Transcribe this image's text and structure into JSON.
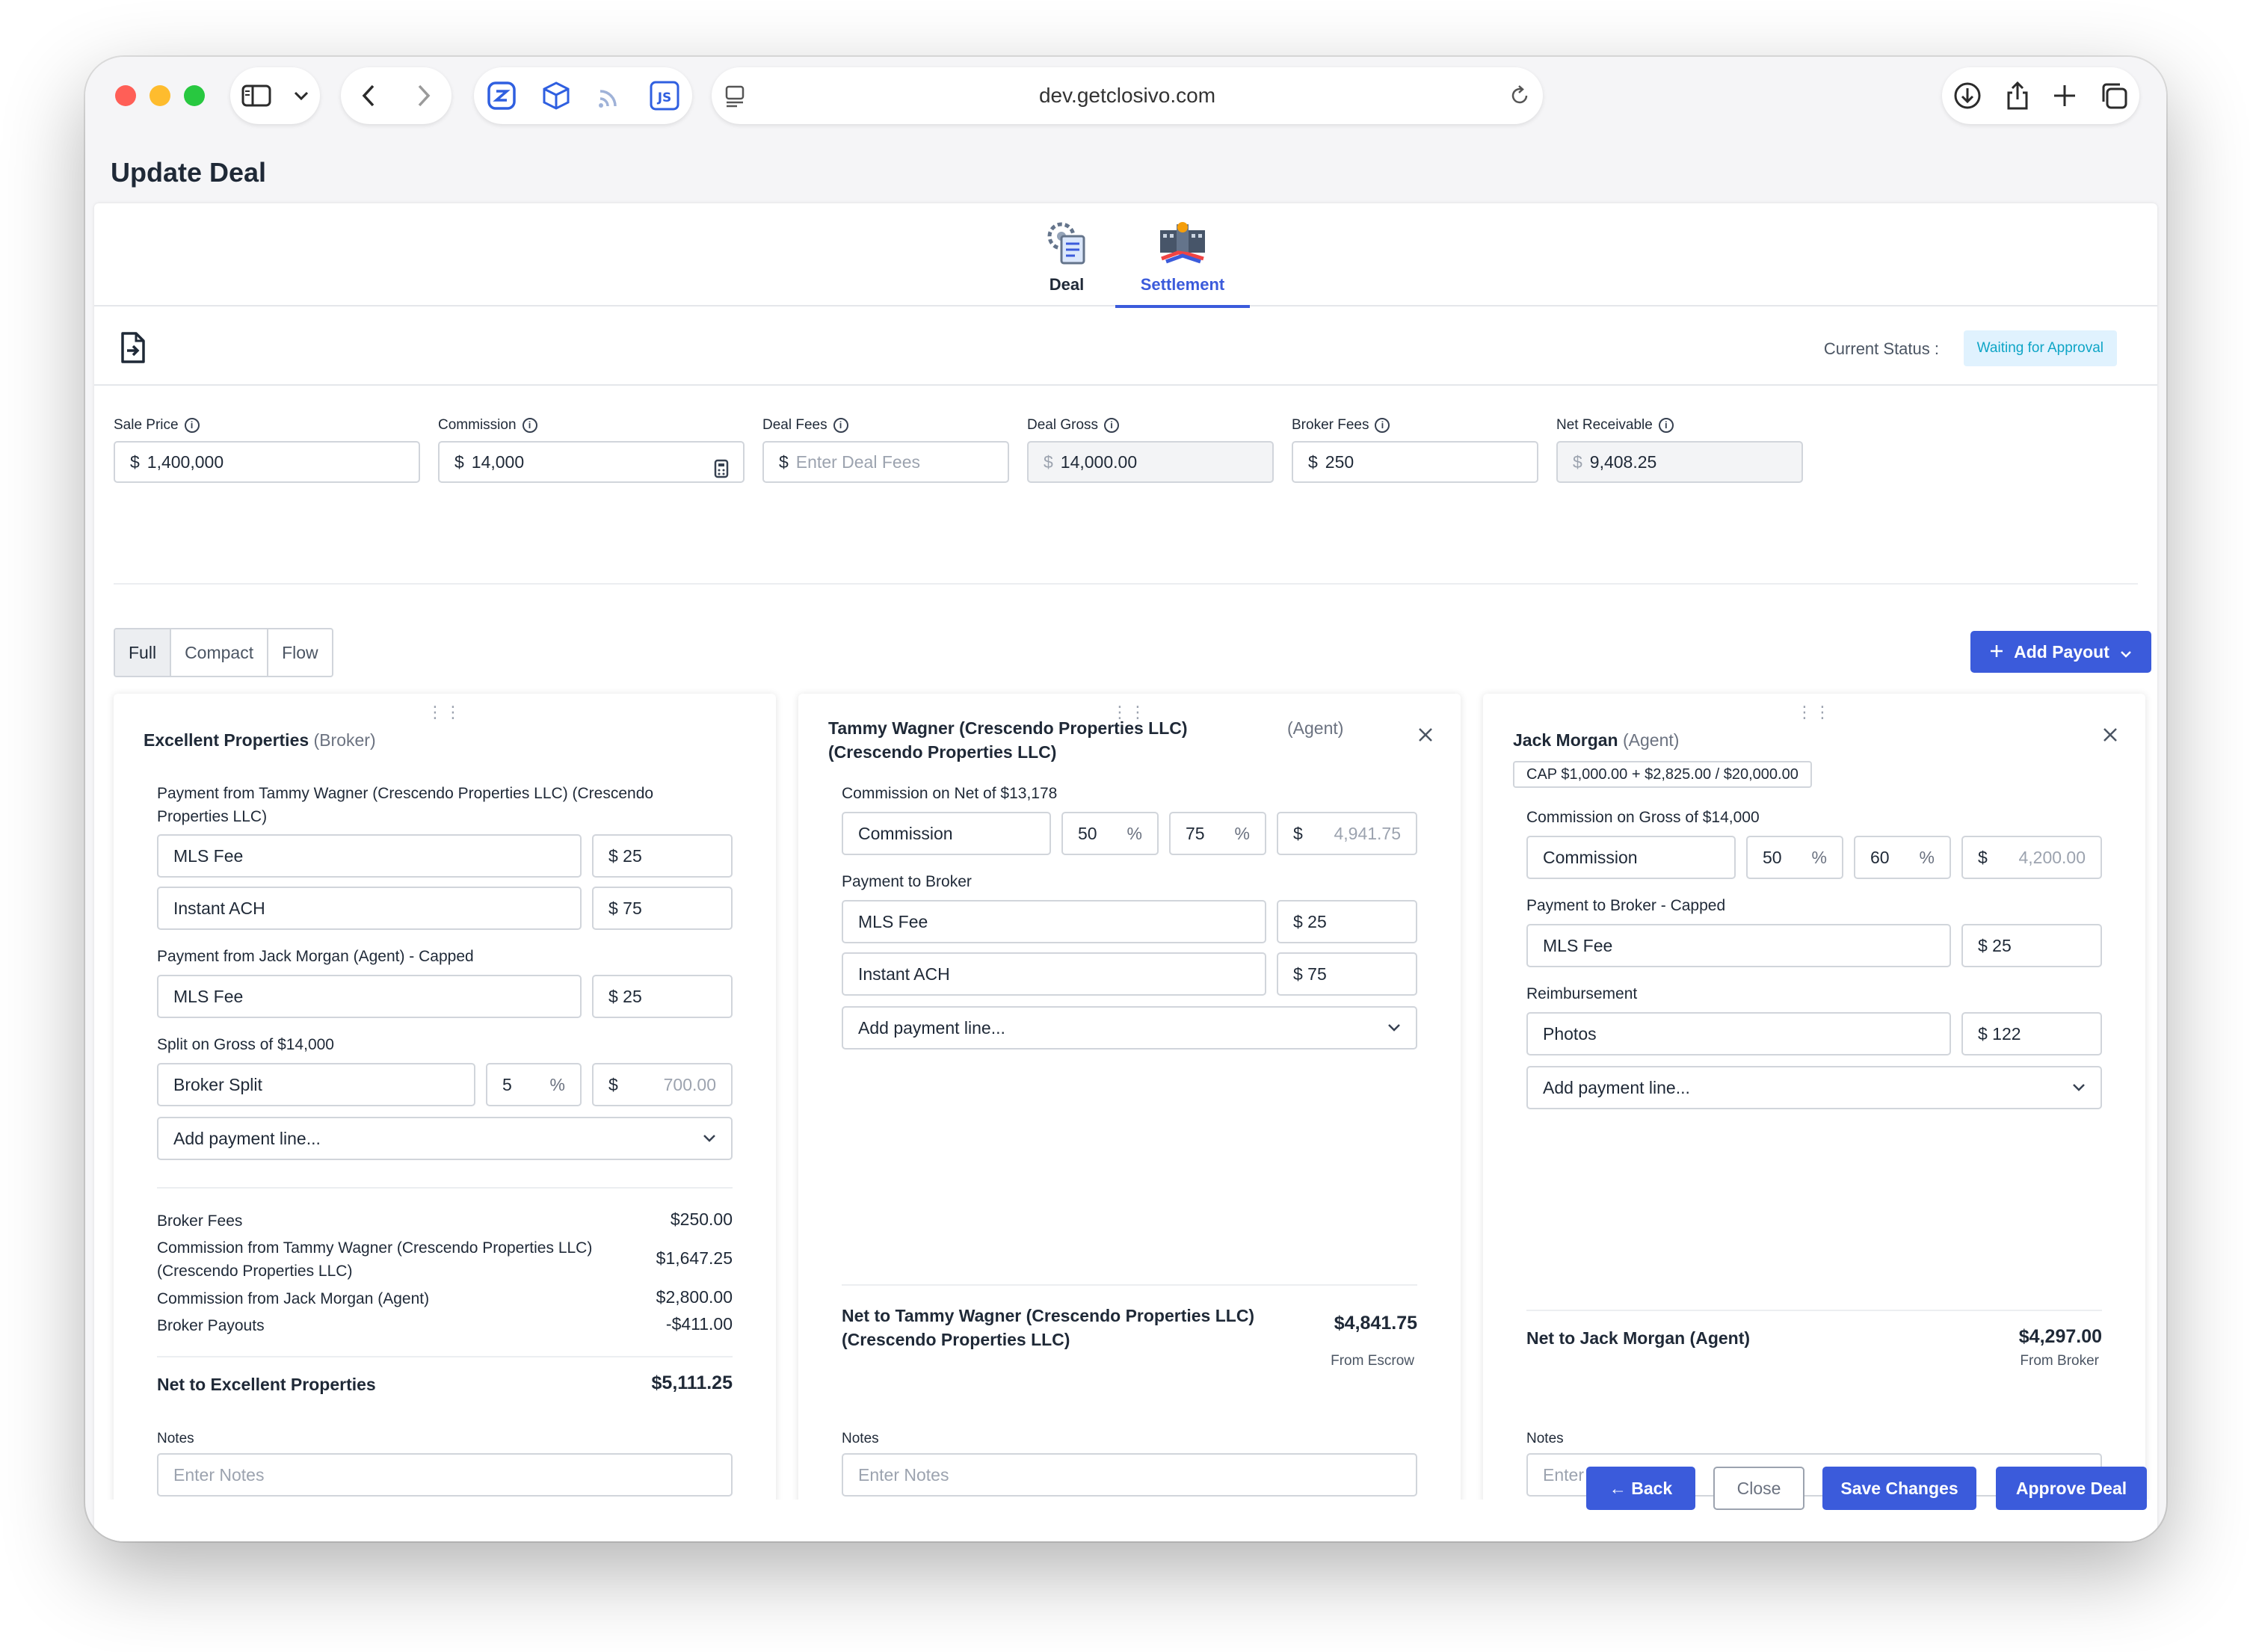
{
  "browser": {
    "url": "dev.getclosivo.com",
    "icons": [
      "sidebar-icon",
      "chevron-down-icon",
      "back-icon",
      "forward-icon",
      "extension-icon",
      "cube-icon",
      "rss-icon",
      "js-icon",
      "page-icon",
      "reload-icon",
      "download-icon",
      "share-icon",
      "new-tab-icon",
      "tabs-overview-icon"
    ]
  },
  "page": {
    "title": "Update Deal"
  },
  "tabs": [
    {
      "label": "Deal",
      "active": false
    },
    {
      "label": "Settlement",
      "active": true
    }
  ],
  "status": {
    "label": "Current Status :",
    "value": "Waiting for Approval"
  },
  "summary_fields": [
    {
      "label": "Sale Price",
      "prefix": "$",
      "value": "1,400,000",
      "readonly": false
    },
    {
      "label": "Commission",
      "prefix": "$",
      "value": "14,000",
      "readonly": false
    },
    {
      "label": "Deal Fees",
      "prefix": "$",
      "value": "",
      "placeholder": "Enter Deal Fees",
      "readonly": false
    },
    {
      "label": "Deal Gross",
      "prefix": "$",
      "value": "14,000.00",
      "readonly": true
    },
    {
      "label": "Broker Fees",
      "prefix": "$",
      "value": "250",
      "readonly": false
    },
    {
      "label": "Net Receivable",
      "prefix": "$",
      "value": "9,408.25",
      "readonly": true
    }
  ],
  "views": {
    "full": "Full",
    "compact": "Compact",
    "flow": "Flow",
    "active": "Full"
  },
  "add_payout": "Add Payout",
  "payouts": {
    "broker": {
      "name": "Excellent Properties",
      "role": "(Broker)",
      "sec1_label": "Payment from Tammy Wagner (Crescendo Properties LLC) (Crescendo Properties LLC)",
      "sec1_lines": [
        {
          "name": "MLS Fee",
          "amount": "$ 25"
        },
        {
          "name": "Instant ACH",
          "amount": "$ 75"
        }
      ],
      "sec2_label": "Payment from Jack Morgan (Agent) - Capped",
      "sec2_lines": [
        {
          "name": "MLS Fee",
          "amount": "$ 25"
        }
      ],
      "split_label": "Split on Gross of $14,000",
      "split_name": "Broker Split",
      "split_pct": "5",
      "pct_unit": "%",
      "split_prefix": "$",
      "split_amount": "700.00",
      "add_line": "Add payment line...",
      "summary": [
        {
          "label": "Broker Fees",
          "value": "$250.00"
        },
        {
          "label": "Commission from Tammy Wagner (Crescendo Properties LLC) (Crescendo Properties LLC)",
          "value": "$1,647.25"
        },
        {
          "label": "Commission from Jack Morgan (Agent)",
          "value": "$2,800.00"
        },
        {
          "label": "Broker Payouts",
          "value": "-$411.00"
        }
      ],
      "net_label": "Net to Excellent Properties",
      "net_value": "$5,111.25",
      "notes_label": "Notes",
      "notes_placeholder": "Enter Notes"
    },
    "agent1": {
      "name": "Tammy Wagner (Crescendo Properties LLC) (Crescendo Properties LLC)",
      "role": "(Agent)",
      "commission_label": "Commission on Net of $13,178",
      "commission_name": "Commission",
      "pct1": "50",
      "pct2": "75",
      "pct_unit": "%",
      "amount_prefix": "$",
      "amount": "4,941.75",
      "pay_label": "Payment to Broker",
      "pay_lines": [
        {
          "name": "MLS Fee",
          "amount": "$ 25"
        },
        {
          "name": "Instant ACH",
          "amount": "$ 75"
        }
      ],
      "add_line": "Add payment line...",
      "net_label": "Net to Tammy Wagner (Crescendo Properties LLC) (Crescendo Properties LLC)",
      "net_value": "$4,841.75",
      "from": "From Escrow",
      "notes_label": "Notes",
      "notes_placeholder": "Enter Notes"
    },
    "agent2": {
      "name": "Jack Morgan",
      "role": "(Agent)",
      "cap": "CAP $1,000.00 + $2,825.00 / $20,000.00",
      "commission_label": "Commission on Gross of $14,000",
      "commission_name": "Commission",
      "pct1": "50",
      "pct2": "60",
      "pct_unit": "%",
      "amount_prefix": "$",
      "amount": "4,200.00",
      "pay_label": "Payment to Broker - Capped",
      "pay_lines": [
        {
          "name": "MLS Fee",
          "amount": "$ 25"
        }
      ],
      "reimb_label": "Reimbursement",
      "reimb_lines": [
        {
          "name": "Photos",
          "amount": "$ 122"
        }
      ],
      "add_line": "Add payment line...",
      "net_label": "Net to Jack Morgan (Agent)",
      "net_value": "$4,297.00",
      "from": "From Broker",
      "notes_label": "Notes",
      "notes_placeholder": "Enter Notes"
    }
  },
  "footer": {
    "back": "← Back",
    "close": "Close",
    "save": "Save Changes",
    "approve": "Approve Deal"
  },
  "colors": {
    "accent": "#3b5bdb",
    "status_bg": "#e0f2fe",
    "status_text": "#0ea5c6"
  }
}
